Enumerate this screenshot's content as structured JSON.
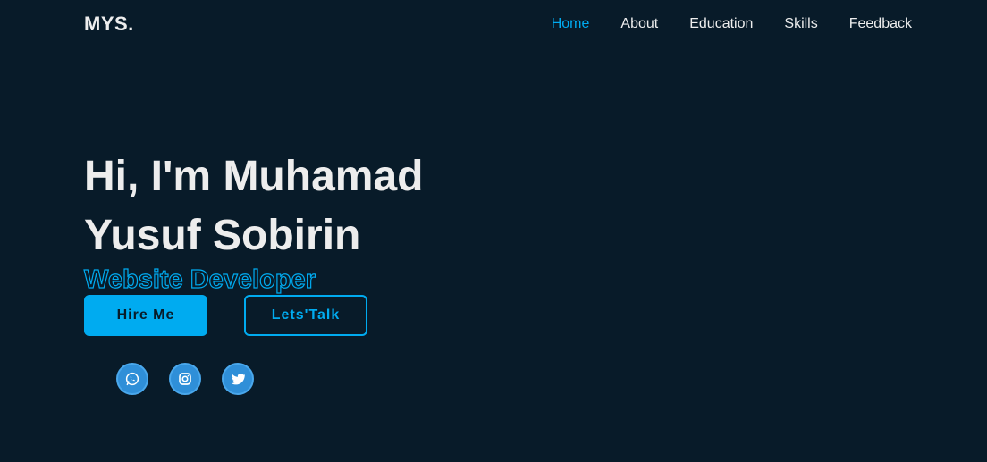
{
  "header": {
    "logo": "MYS.",
    "nav": [
      {
        "label": "Home",
        "active": true
      },
      {
        "label": "About"
      },
      {
        "label": "Education"
      },
      {
        "label": "Skills"
      },
      {
        "label": "Feedback"
      }
    ]
  },
  "hero": {
    "greeting_line1": "Hi, I'm Muhamad",
    "greeting_line2": "Yusuf Sobirin",
    "role": "Website Developer",
    "hire_button": "Hire Me",
    "talk_button": "Lets'Talk"
  },
  "socials": [
    "whatsapp-icon",
    "instagram-icon",
    "twitter-icon"
  ],
  "colors": {
    "background": "#081b29",
    "accent": "#00abf0",
    "text": "#ededed",
    "social_bg": "#2f8fd8"
  }
}
